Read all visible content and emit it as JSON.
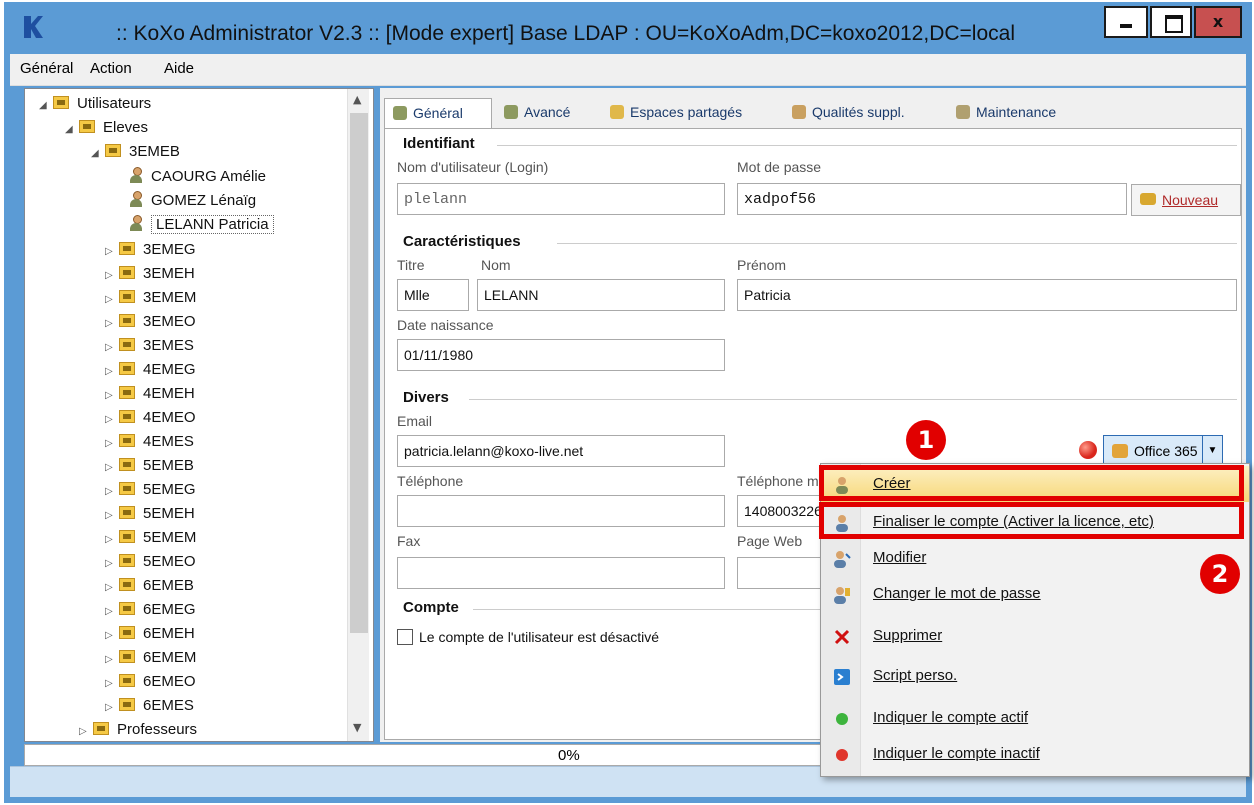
{
  "window": {
    "title": ":: KoXo Administrator V2.3 :: [Mode expert] Base LDAP : OU=KoXoAdm,DC=koxo2012,DC=local",
    "close_label": "x",
    "colors": {
      "titlebar": "#5b9bd5",
      "highlight": "#e10000"
    }
  },
  "menubar": {
    "items": [
      "Général",
      "Action",
      "Aide"
    ]
  },
  "tree": {
    "root": "Utilisateurs",
    "eleves": "Eleves",
    "class_open": "3EMEB",
    "users": [
      "CAOURG Amélie",
      "GOMEZ Lénaïg",
      "LELANN Patricia"
    ],
    "classes": [
      "3EMEG",
      "3EMEH",
      "3EMEM",
      "3EMEO",
      "3EMES",
      "4EMEG",
      "4EMEH",
      "4EMEO",
      "4EMES",
      "5EMEB",
      "5EMEG",
      "5EMEH",
      "5EMEM",
      "5EMEO",
      "6EMEB",
      "6EMEG",
      "6EMEH",
      "6EMEM",
      "6EMEO",
      "6EMES"
    ],
    "professeurs": "Professeurs"
  },
  "tabs": [
    "Général",
    "Avancé",
    "Espaces partagés",
    "Qualités suppl.",
    "Maintenance"
  ],
  "form": {
    "identifiant_title": "Identifiant",
    "login_label": "Nom d'utilisateur (Login)",
    "login_value": "plelann",
    "password_label": "Mot de passe",
    "password_value": "xadpof56",
    "nouveau": "Nouveau",
    "carac_title": "Caractéristiques",
    "titre_label": "Titre",
    "titre_value": "Mlle",
    "nom_label": "Nom",
    "nom_value": "LELANN",
    "prenom_label": "Prénom",
    "prenom_value": "Patricia",
    "dob_label": "Date naissance",
    "dob_value": "01/11/1980",
    "divers_title": "Divers",
    "email_label": "Email",
    "email_value": "patricia.lelann@koxo-live.net",
    "tel_label": "Téléphone",
    "mobile_label": "Téléphone m",
    "mobile_value": "1408003226",
    "fax_label": "Fax",
    "web_label": "Page Web",
    "compte_title": "Compte",
    "disabled_label": "Le compte de l'utilisateur est désactivé",
    "office_button": "Office 365"
  },
  "progress": {
    "label": "0%",
    "value": 0
  },
  "context_menu": {
    "items": [
      "Créer",
      "Finaliser le compte (Activer la licence, etc)",
      "Modifier",
      "Changer le mot de passe",
      "Supprimer",
      "Script perso.",
      "Indiquer le compte actif",
      "Indiquer le compte inactif"
    ]
  },
  "badges": [
    "1",
    "2"
  ]
}
